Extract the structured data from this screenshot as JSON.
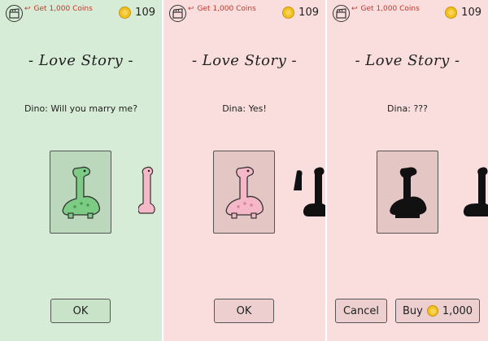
{
  "colors": {
    "green_bg": "#d6ecd6",
    "pink_bg": "#f9dedd",
    "dino_green": "#7ccc86",
    "dino_pink": "#f5b8c8"
  },
  "topbar": {
    "hint": "Get 1,000 Coins",
    "coins": "109"
  },
  "panels": [
    {
      "title": "- Love Story -",
      "dialogue": "Dino: Will you marry me?",
      "ok_label": "OK"
    },
    {
      "title": "- Love Story -",
      "dialogue": "Dina: Yes!",
      "ok_label": "OK"
    },
    {
      "title": "- Love Story -",
      "dialogue": "Dina: ???",
      "cancel_label": "Cancel",
      "buy_label": "Buy",
      "price": "1,000"
    }
  ],
  "icons": [
    "clapperboard-icon",
    "arrow-icon",
    "coin-icon"
  ]
}
